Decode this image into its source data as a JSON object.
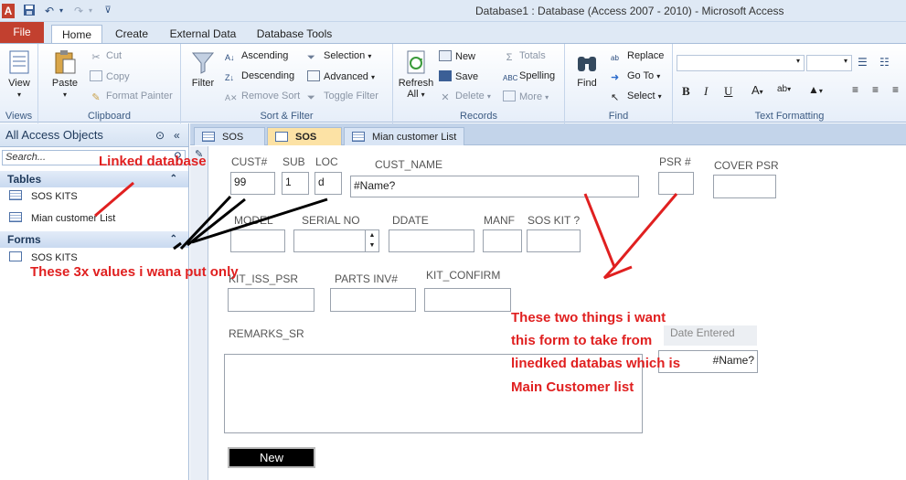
{
  "titlebar": {
    "title": "Database1 : Database (Access 2007 - 2010)  -  Microsoft Access"
  },
  "ribbon_tabs": {
    "file": "File",
    "home": "Home",
    "create": "Create",
    "external_data": "External Data",
    "database_tools": "Database Tools"
  },
  "ribbon": {
    "views": {
      "view": "View",
      "label": "Views"
    },
    "clipboard": {
      "paste": "Paste",
      "cut": "Cut",
      "copy": "Copy",
      "format_painter": "Format Painter",
      "label": "Clipboard"
    },
    "sort_filter": {
      "filter": "Filter",
      "ascending": "Ascending",
      "descending": "Descending",
      "remove_sort": "Remove Sort",
      "selection": "Selection",
      "advanced": "Advanced",
      "toggle_filter": "Toggle Filter",
      "label": "Sort & Filter"
    },
    "records": {
      "refresh_line1": "Refresh",
      "refresh_line2": "All",
      "new": "New",
      "save": "Save",
      "delete": "Delete",
      "totals": "Totals",
      "spelling": "Spelling",
      "more": "More",
      "label": "Records"
    },
    "find": {
      "find": "Find",
      "replace": "Replace",
      "goto": "Go To",
      "select": "Select",
      "label": "Find"
    },
    "text_formatting": {
      "bold": "B",
      "italic": "I",
      "underline": "U",
      "label": "Text Formatting"
    }
  },
  "nav": {
    "header": "All Access Objects",
    "search_placeholder": "Search...",
    "tables_header": "Tables",
    "tables": [
      "SOS KITS",
      "Mian customer List"
    ],
    "forms_header": "Forms",
    "forms": [
      "SOS KITS"
    ]
  },
  "doc_tabs": [
    "SOS KITS",
    "SOS KITS",
    "Mian customer List"
  ],
  "form": {
    "labels": {
      "cust": "CUST#",
      "sub": "SUB",
      "loc": "LOC",
      "cust_name": "CUST_NAME",
      "psr": "PSR #",
      "cover_psr": "COVER PSR",
      "model": "MODEL",
      "serial_no": "SERIAL NO",
      "ddate": "DDATE",
      "manf": "MANF",
      "sos_kit": "SOS KIT ?",
      "kit_iss_psr": "KIT_ISS_PSR",
      "parts_inv": "PARTS INV#",
      "kit_confirm": "KIT_CONFIRM",
      "remarks": "REMARKS_SR",
      "date_entered": "Date Entered"
    },
    "values": {
      "cust": "99",
      "sub": "1",
      "loc": "d",
      "cust_name": "#Name?",
      "name2": "#Name?"
    },
    "new_button": "New"
  },
  "annotations": {
    "linked": "Linked database",
    "three_values": "These 3x values i wana put only",
    "two_things": [
      "These two things i want",
      "this form to take from",
      "linedked databas which is",
      "Main Customer list"
    ]
  },
  "colors": {
    "annotation": "#e02020",
    "file_tab": "#c2402f",
    "active_doc_tab": "#fce2a5"
  }
}
